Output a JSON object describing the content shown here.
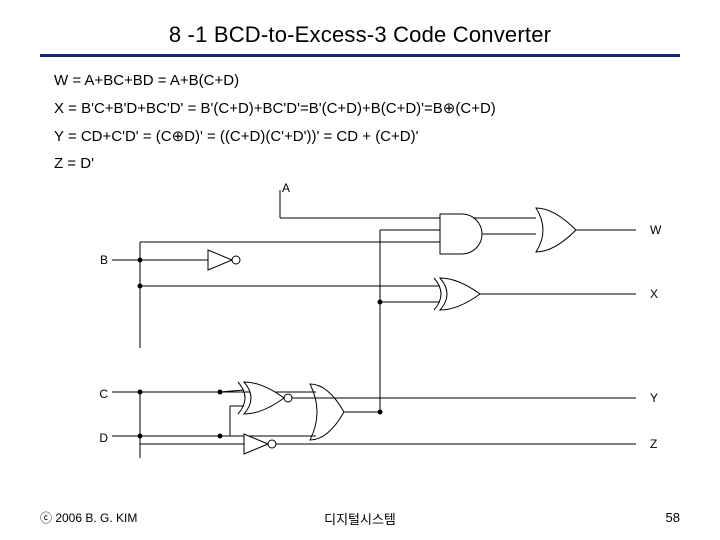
{
  "title": "8 -1 BCD-to-Excess-3 Code Converter",
  "equations": {
    "w": "W = A+BC+BD = A+B(C+D)",
    "x": "X = B'C+B'D+BC'D' = B'(C+D)+BC'D'=B'(C+D)+B(C+D)'=B⊕(C+D)",
    "y": "Y = CD+C'D' = (C⊕D)' = ((C+D)(C'+D'))' = CD + (C+D)'",
    "z": "Z = D'"
  },
  "circuit": {
    "inputs": {
      "A": "A",
      "B": "B",
      "C": "C",
      "D": "D"
    },
    "outputs": {
      "W": "W",
      "X": "X",
      "Y": "Y",
      "Z": "Z"
    }
  },
  "footer": {
    "copyright": "ⓒ 2006  B. G. KIM",
    "center": "디지털시스템",
    "page": "58"
  }
}
